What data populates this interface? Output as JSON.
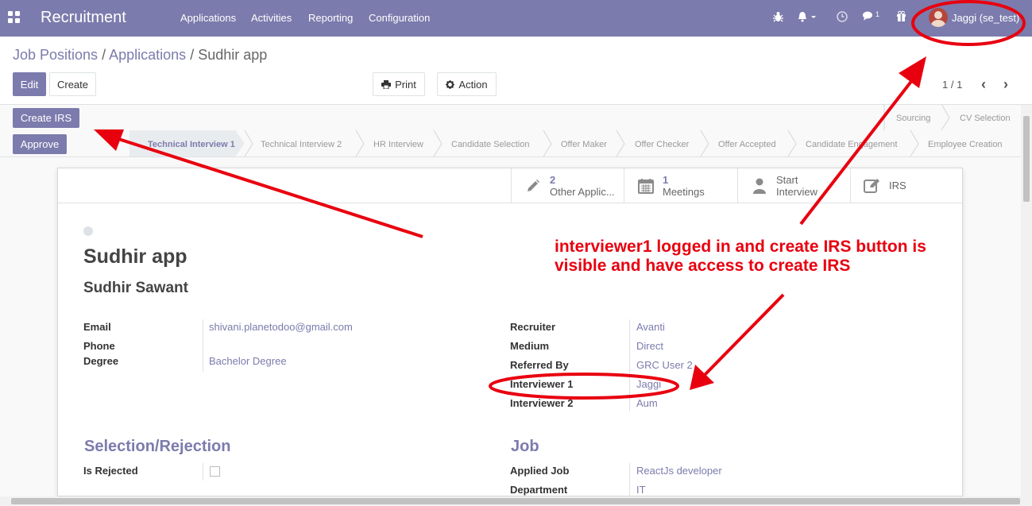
{
  "navbar": {
    "brand": "Recruitment",
    "menu": [
      "Applications",
      "Activities",
      "Reporting",
      "Configuration"
    ],
    "icons": [
      "bug-icon",
      "bell-icon",
      "clock-icon",
      "chat-icon",
      "gift-icon"
    ],
    "chat_badge": "1",
    "user": "Jaggi (se_test)",
    "color": "#7c7bad"
  },
  "breadcrumb": {
    "items": [
      "Job Positions",
      "Applications",
      "Sudhir app"
    ],
    "separator": "/"
  },
  "toolbar": {
    "edit": "Edit",
    "create": "Create",
    "print": "Print",
    "action": "Action",
    "pager": "1 / 1"
  },
  "header_buttons": {
    "create_irs": "Create IRS",
    "approve": "Approve"
  },
  "stages": {
    "top": [
      "Sourcing",
      "CV Selection"
    ],
    "main": [
      "Technical Interview 1",
      "Technical Interview 2",
      "HR Interview",
      "Candidate Selection",
      "Offer Maker",
      "Offer Checker",
      "Offer Accepted",
      "Candidate Engagement",
      "Employee Creation"
    ],
    "active": "Technical Interview 1"
  },
  "smart_buttons": [
    {
      "count": "2",
      "label": "Other Applic...",
      "icon": "pencil-icon"
    },
    {
      "count": "1",
      "label": "Meetings",
      "icon": "calendar-icon"
    },
    {
      "line1": "Start",
      "line2": "Interview",
      "icon": "user-icon"
    },
    {
      "label": "IRS",
      "icon": "edit-icon"
    }
  ],
  "record": {
    "name": "Sudhir app",
    "applicant": "Sudhir Sawant"
  },
  "left_fields": {
    "email_label": "Email",
    "email": "shivani.planetodoo@gmail.com",
    "phone_label": "Phone",
    "phone": "",
    "degree_label": "Degree",
    "degree": "Bachelor Degree"
  },
  "right_fields": {
    "recruiter_label": "Recruiter",
    "recruiter": "Avanti",
    "medium_label": "Medium",
    "medium": "Direct",
    "referred_label": "Referred By",
    "referred": "GRC User 2",
    "interviewer1_label": "Interviewer 1",
    "interviewer1": "Jaggi",
    "interviewer2_label": "Interviewer 2",
    "interviewer2": "Aum"
  },
  "sections": {
    "selection_title": "Selection/Rejection",
    "is_rejected_label": "Is Rejected",
    "job_title": "Job",
    "applied_job_label": "Applied Job",
    "applied_job": "ReactJs developer",
    "department_label": "Department",
    "department": "IT"
  },
  "annotation": {
    "text": "interviewer1 logged in and create IRS button is visible and have access to create IRS",
    "color": "#e8000f"
  }
}
